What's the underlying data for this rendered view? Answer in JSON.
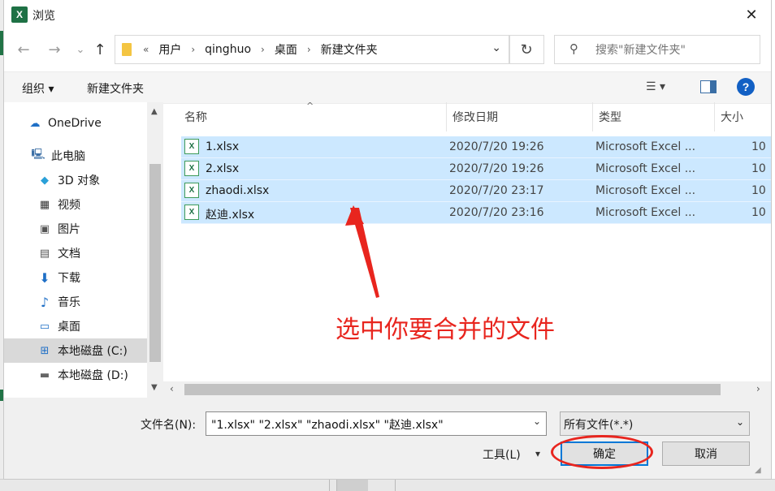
{
  "window": {
    "title": "浏览",
    "close_label": "✕"
  },
  "nav": {
    "back": "←",
    "forward": "→",
    "recent": "⌄",
    "up": "↑",
    "breadcrumb_overflow": "«",
    "breadcrumbs": [
      "用户",
      "qinghuo",
      "桌面",
      "新建文件夹"
    ],
    "refresh": "↻"
  },
  "search": {
    "placeholder": "搜索\"新建文件夹\""
  },
  "toolbar": {
    "organize": "组织 ▾",
    "new_folder": "新建文件夹"
  },
  "sidebar": {
    "items": [
      {
        "label": "OneDrive",
        "icon": "cloud-icon"
      },
      {
        "label": "此电脑",
        "icon": "computer-icon"
      },
      {
        "label": "3D 对象",
        "icon": "cube-icon"
      },
      {
        "label": "视频",
        "icon": "video-icon"
      },
      {
        "label": "图片",
        "icon": "picture-icon"
      },
      {
        "label": "文档",
        "icon": "document-icon"
      },
      {
        "label": "下载",
        "icon": "download-icon"
      },
      {
        "label": "音乐",
        "icon": "music-icon"
      },
      {
        "label": "桌面",
        "icon": "desktop-icon"
      },
      {
        "label": "本地磁盘 (C:)",
        "icon": "drive-icon",
        "selected": true
      },
      {
        "label": "本地磁盘 (D:)",
        "icon": "drive-icon"
      }
    ]
  },
  "columns": {
    "name": "名称",
    "date": "修改日期",
    "type": "类型",
    "size": "大小"
  },
  "files": [
    {
      "name": "1.xlsx",
      "date": "2020/7/20 19:26",
      "type": "Microsoft Excel ...",
      "size": "10"
    },
    {
      "name": "2.xlsx",
      "date": "2020/7/20 19:26",
      "type": "Microsoft Excel ...",
      "size": "10"
    },
    {
      "name": "zhaodi.xlsx",
      "date": "2020/7/20 23:17",
      "type": "Microsoft Excel ...",
      "size": "10"
    },
    {
      "name": "赵迪.xlsx",
      "date": "2020/7/20 23:16",
      "type": "Microsoft Excel ...",
      "size": "10"
    }
  ],
  "annotation": {
    "text": "选中你要合并的文件",
    "color": "#e8251e"
  },
  "footer": {
    "filename_label": "文件名(N):",
    "filename_value": "\"1.xlsx\" \"2.xlsx\" \"zhaodi.xlsx\" \"赵迪.xlsx\"",
    "filter": "所有文件(*.*)",
    "tools": "工具(L)",
    "ok": "确定",
    "cancel": "取消"
  },
  "colors": {
    "selection": "#cce8ff",
    "accent": "#0078d7",
    "excel_green": "#1e7145"
  }
}
